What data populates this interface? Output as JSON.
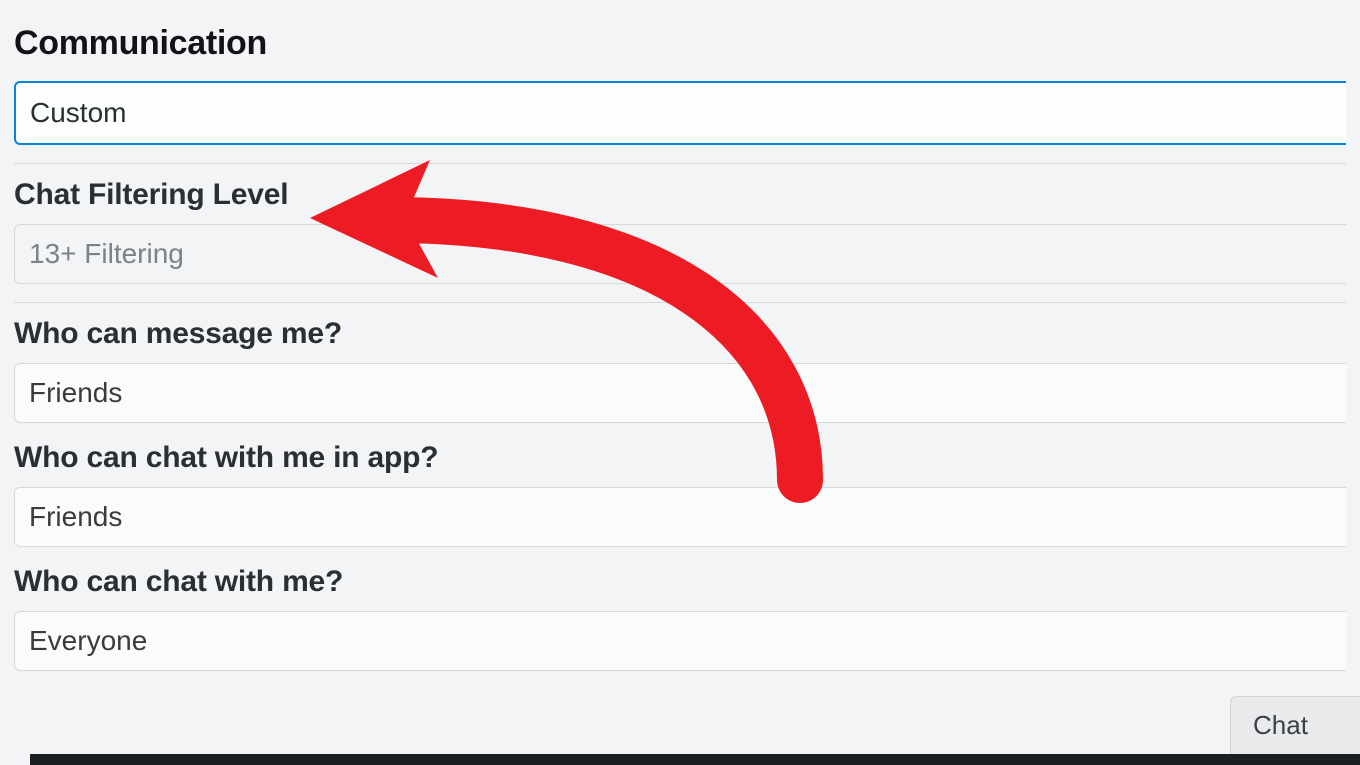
{
  "section": {
    "title": "Communication"
  },
  "communication": {
    "preset": "Custom"
  },
  "fields": {
    "chat_filtering": {
      "label": "Chat Filtering Level",
      "value": "13+ Filtering"
    },
    "who_message": {
      "label": "Who can message me?",
      "value": "Friends"
    },
    "who_chat_app": {
      "label": "Who can chat with me in app?",
      "value": "Friends"
    },
    "who_chat": {
      "label": "Who can chat with me?",
      "value": "Everyone"
    }
  },
  "chat_tab": {
    "label": "Chat"
  },
  "annotation": {
    "arrow_color": "#ed1c24"
  }
}
